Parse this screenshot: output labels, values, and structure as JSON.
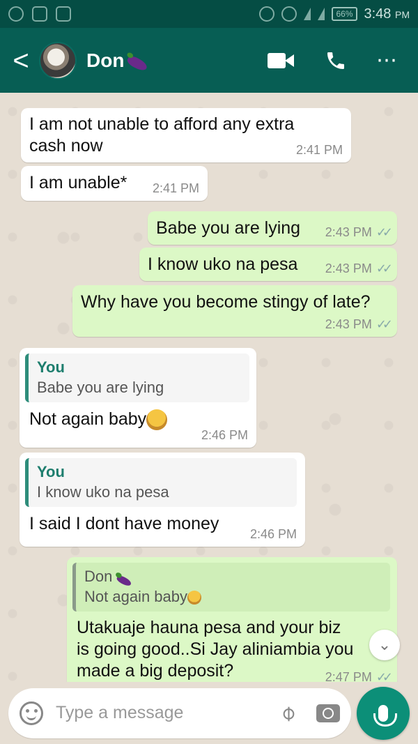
{
  "status_bar": {
    "battery": "66%",
    "time": "3:48",
    "ampm": "PM"
  },
  "header": {
    "back_label": "<",
    "contact_name": "Don",
    "menu_label": "⋯"
  },
  "messages": [
    {
      "dir": "in",
      "text_line1": "I am not unable to afford any extra",
      "text_line2": "cash now",
      "time": "2:41 PM"
    },
    {
      "dir": "in",
      "text": "I am unable*",
      "time": "2:41 PM"
    },
    {
      "dir": "out",
      "text": "Babe you are lying",
      "time": "2:43 PM"
    },
    {
      "dir": "out",
      "text": "I know uko na pesa",
      "time": "2:43 PM"
    },
    {
      "dir": "out",
      "text": "Why have you become stingy of late?",
      "time": "2:43 PM"
    },
    {
      "dir": "in",
      "quote_author": "You",
      "quote_text": "Babe you are lying",
      "text": "Not again baby",
      "time": "2:46 PM"
    },
    {
      "dir": "in",
      "quote_author": "You",
      "quote_text": "I know uko na pesa",
      "text": "I said I dont have money",
      "time": "2:46 PM"
    },
    {
      "dir": "out",
      "quote_author": "Don",
      "quote_text": "Not again baby",
      "text_line1": "Utakuaje hauna pesa and your biz",
      "text_line2": "is going good..Si Jay aliniambia you",
      "text_line3": "made a big deposit?",
      "time": "2:47 PM"
    }
  ],
  "input": {
    "placeholder": "Type a message"
  },
  "colors": {
    "header": "#075e54",
    "statusbar": "#054d44",
    "outgoing": "#dcf8c6",
    "incoming": "#ffffff",
    "accent": "#0c8f78"
  }
}
